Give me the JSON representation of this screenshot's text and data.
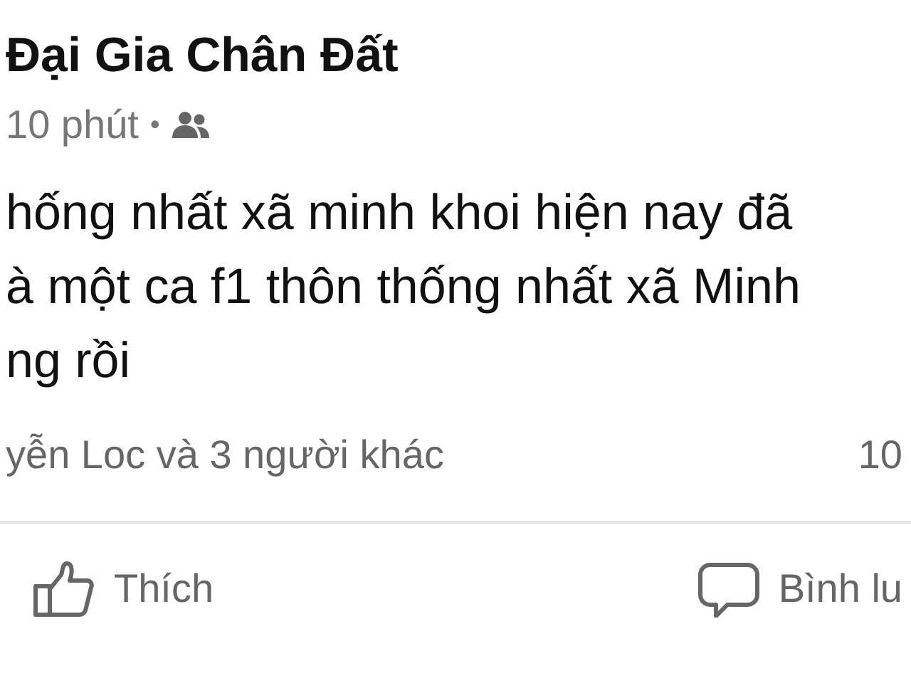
{
  "post": {
    "author": "Đại Gia Chân Đất",
    "time": "10 phút",
    "separator": "•",
    "body_lines": [
      "hống nhất xã minh khoi hiện nay đã",
      "à một ca f1 thôn thống nhất xã Minh",
      "ng rồi"
    ],
    "reactions": "yễn Loc và 3 người khác",
    "comments_count": "10",
    "actions": [
      {
        "kind": "like",
        "label": "Thích"
      },
      {
        "kind": "comment",
        "label": "Bình lu"
      }
    ]
  }
}
